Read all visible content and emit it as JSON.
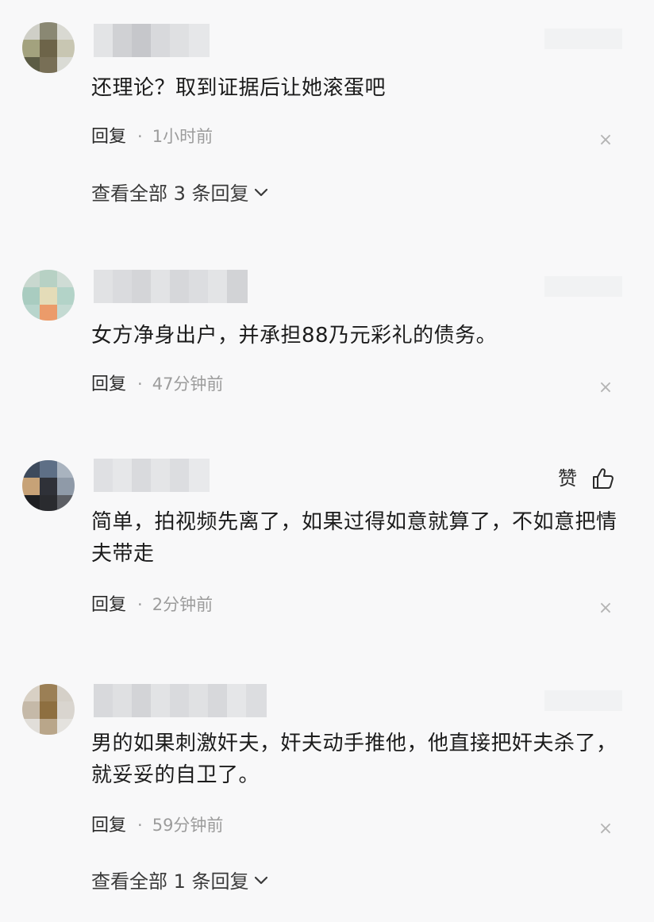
{
  "comments": [
    {
      "text": "还理论？取到证据后让她滚蛋吧",
      "reply_label": "回复",
      "dot": "·",
      "time": "1小时前",
      "close": "×",
      "view_all": "查看全部 3 条回复"
    },
    {
      "text": "女方净身出户，并承担88乃元彩礼的债务。",
      "reply_label": "回复",
      "dot": "·",
      "time": "47分钟前",
      "close": "×"
    },
    {
      "text": "简单，拍视频先离了，如果过得如意就算了，不如意把情夫带走",
      "reply_label": "回复",
      "dot": "·",
      "time": "2分钟前",
      "close": "×",
      "like_label": "赞"
    },
    {
      "text": "男的如果刺激奸夫，奸夫动手推他，他直接把奸夫杀了，就妥妥的自卫了。",
      "reply_label": "回复",
      "dot": "·",
      "time": "59分钟前",
      "close": "×",
      "view_all": "查看全部 1 条回复"
    }
  ],
  "icons": {
    "like": "thumbs-up-icon",
    "expand": "chevron-down-icon",
    "close": "close-icon"
  },
  "colors": {
    "background": "#f8f8f9",
    "text": "#1c1c1c",
    "meta": "#9c9c9c",
    "close": "#b4b4b4"
  }
}
